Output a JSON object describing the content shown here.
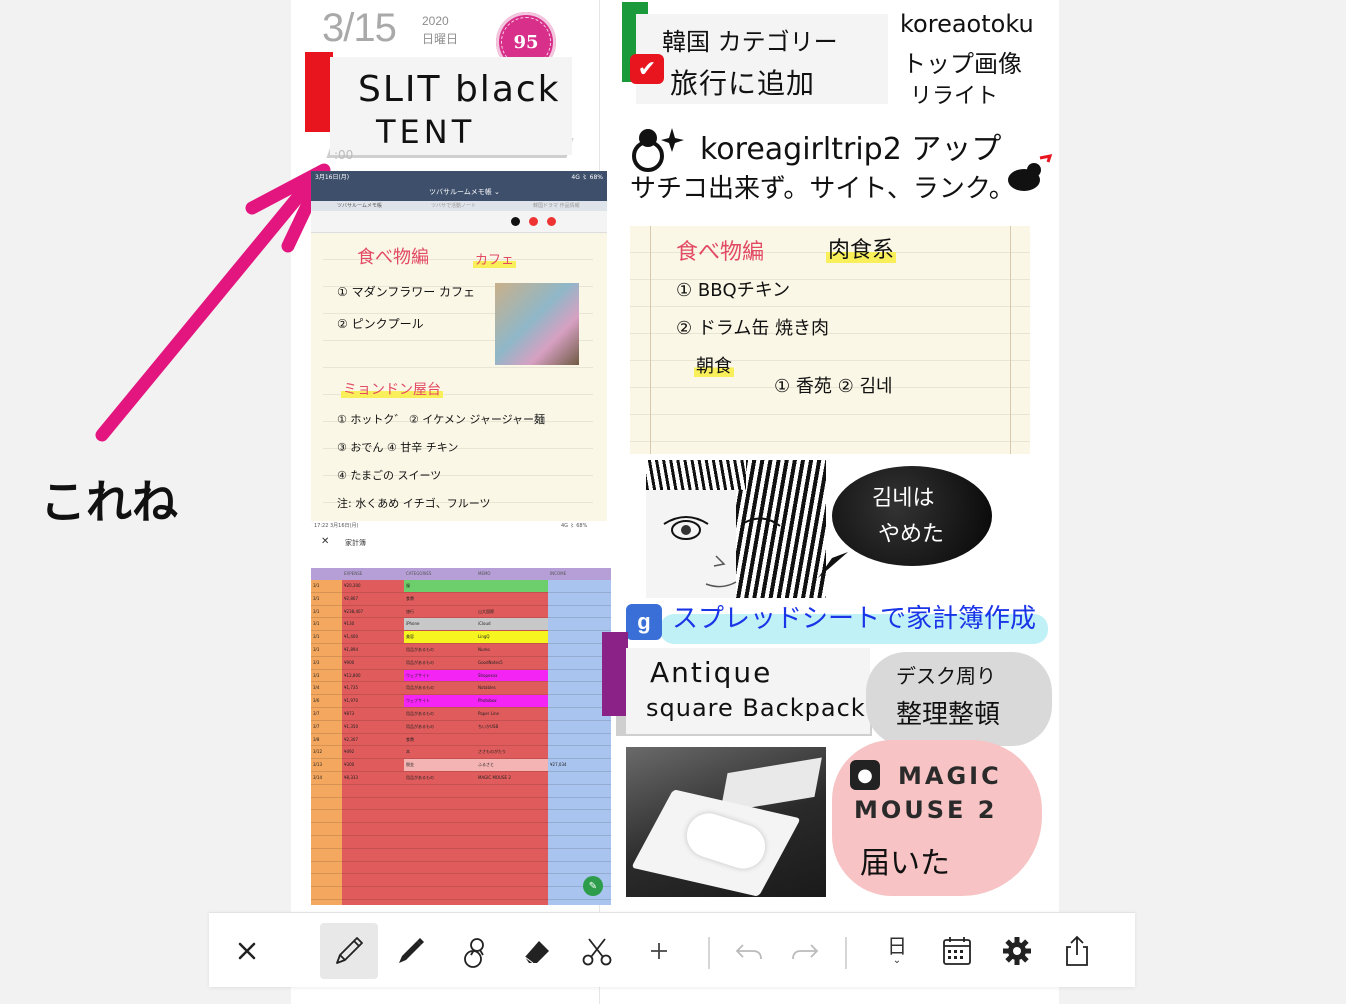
{
  "header": {
    "date": "3/15",
    "year": "2020",
    "weekday": "日曜日",
    "badge": "95",
    "time": ":00"
  },
  "left_column": {
    "tent_label": {
      "line1": "SLIT black",
      "line2": "TENT"
    },
    "annotation": "これね",
    "phone_screenshot": {
      "status_time": "3月16日(月)",
      "status_right": "4G 〻 68%",
      "title": "ツバサルームメモ帳 ⌄",
      "tabs": [
        "ツバサルームメモ帳",
        "ツバサで活動ノート",
        "韓国ドラマ 作品情報"
      ],
      "note": {
        "heading": "食べ物編",
        "heading_tag": "カフェ",
        "items1": [
          "① マダンフラワー カフェ",
          "② ピンクプール"
        ],
        "subheading": "ミョンドン屋台",
        "items2": [
          "① ホットク゛  ② イケメン ジャージャー麺",
          "③ おでん  ④ 甘辛 チキン",
          "④ たまごの スイーツ",
          "注: 水くあめ イチゴ、フルーツ"
        ]
      }
    },
    "spreadsheet": {
      "status_time": "17:22  3月16日(月)",
      "status_right": "4G 〻 68%",
      "title": "家計簿",
      "headers": [
        "",
        "EXPENSE",
        "CATEGORIES",
        "MEMO",
        "INCOME"
      ],
      "rows": [
        [
          "3/1",
          "¥20,300",
          "服",
          "",
          ""
        ],
        [
          "3/1",
          "¥2,867",
          "食費",
          "",
          ""
        ],
        [
          "3/1",
          "¥238,407",
          "旅行",
          "山大国際",
          ""
        ],
        [
          "3/1",
          "¥130",
          "iPhone",
          "iCloud",
          ""
        ],
        [
          "3/1",
          "¥1,400",
          "美容",
          "LingQ",
          ""
        ],
        [
          "3/1",
          "¥1,894",
          "用品があるもの",
          "Numo",
          ""
        ],
        [
          "3/3",
          "¥900",
          "用品があるもの",
          "GoodNotes5",
          ""
        ],
        [
          "3/3",
          "¥12,800",
          "ウェブサイト",
          "Shopexxx",
          ""
        ],
        [
          "3/4",
          "¥1,735",
          "用品があるもの",
          "Notables",
          ""
        ],
        [
          "3/6",
          "¥1,970",
          "ウェブサイト",
          "Photobox",
          ""
        ],
        [
          "3/7",
          "¥873",
          "用品があるもの",
          "Paper Line",
          ""
        ],
        [
          "3/7",
          "¥1,350",
          "用品があるもの",
          "ちいかUSB",
          ""
        ],
        [
          "3/8",
          "¥2,307",
          "食費",
          "",
          ""
        ],
        [
          "3/12",
          "¥492",
          "本",
          "ささものがたり",
          ""
        ],
        [
          "3/13",
          "¥300",
          "税金",
          "ふるさと",
          "¥27,034"
        ],
        [
          "3/14",
          "¥8,333",
          "用品があるもの",
          "MAGIC MOUSE 2",
          ""
        ]
      ]
    }
  },
  "right_column": {
    "category_label": {
      "line1": "韓国 カテゴリー",
      "line2": "旅行に追加"
    },
    "koreaotoku": {
      "line1": "koreaotoku",
      "line2": "トップ画像",
      "line3": "リライト"
    },
    "koreagirl": {
      "line1": "koreagirltrip2 アップ",
      "line2": "サチコ出来ず。サイト、ランク。"
    },
    "note2": {
      "heading": "食べ物編",
      "heading_tag": "肉食系",
      "items": [
        "① BBQチキン",
        "② ドラム缶 焼き肉"
      ],
      "sub": "朝食",
      "sub_items": "① 香苑  ② 김네"
    },
    "speech": {
      "line1": "김네は",
      "line2": "やめた"
    },
    "spreadsheet_note": "スプレッドシートで家計簿作成",
    "backpack_label": {
      "line1": "Antique",
      "line2": "square Backpack"
    },
    "desk_note": {
      "line1": "デスク周り",
      "line2": "整理整頓"
    },
    "magic_mouse": {
      "line1": "MAGIC",
      "line2": "MOUSE 2",
      "line3": "届いた"
    }
  },
  "toolbar": {
    "items": [
      {
        "icon": "close-icon"
      },
      {
        "icon": "pencil-icon"
      },
      {
        "icon": "pen-icon"
      },
      {
        "icon": "stamp-icon"
      },
      {
        "icon": "eraser-icon"
      },
      {
        "icon": "scissors-icon"
      },
      {
        "icon": "plus-icon"
      },
      {
        "icon": "undo-icon"
      },
      {
        "icon": "redo-icon"
      },
      {
        "icon": "date-view-icon"
      },
      {
        "icon": "calendar-icon"
      },
      {
        "icon": "gear-icon"
      },
      {
        "icon": "share-icon"
      }
    ],
    "date_view_label": "日"
  },
  "colors": {
    "badge": "#d82f8a",
    "arrow": "#e3167f",
    "tab_red": "#e8141e",
    "tab_green": "#1a9a3a",
    "tab_purple": "#8a2288"
  }
}
